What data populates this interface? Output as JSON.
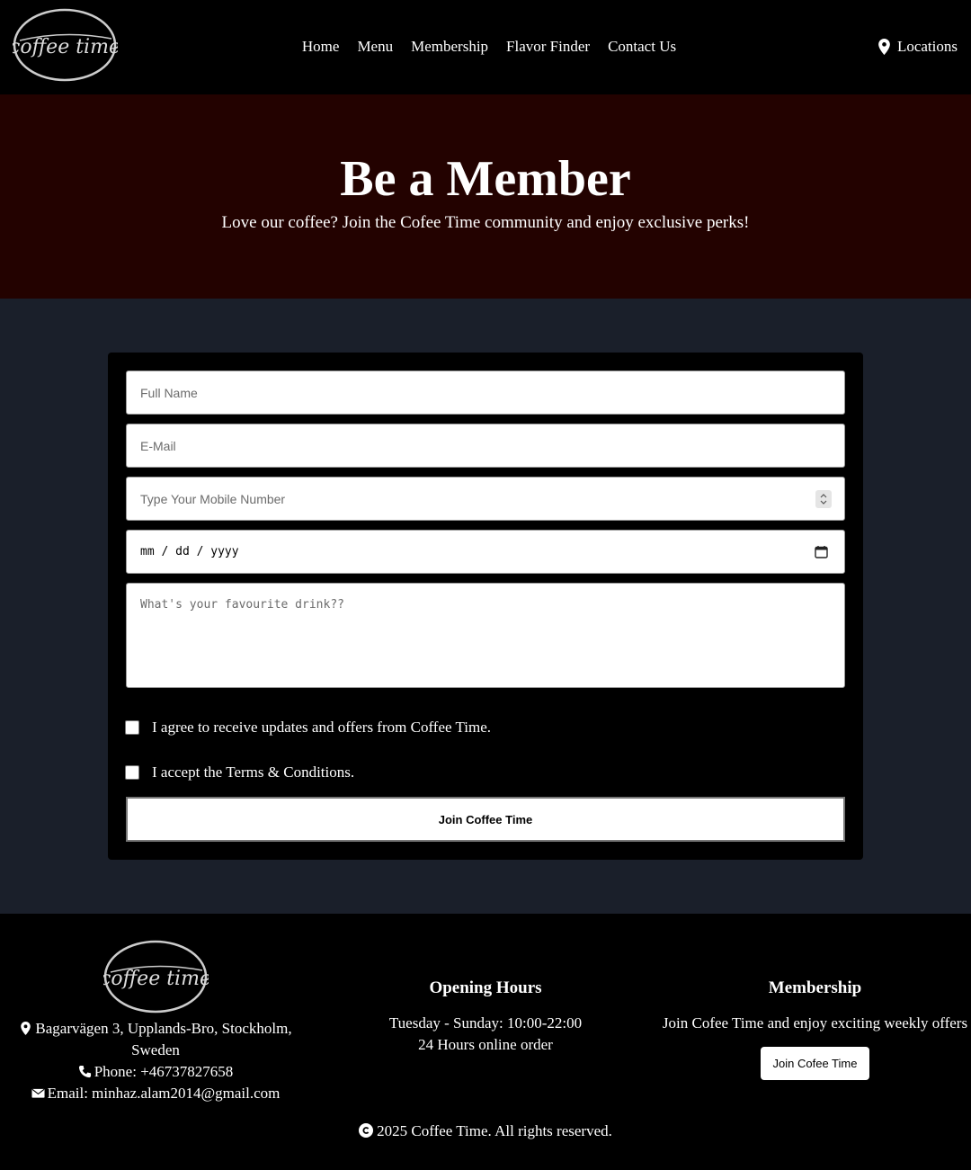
{
  "brand": {
    "logo_text": "coffee time"
  },
  "nav": {
    "items": [
      {
        "label": "Home"
      },
      {
        "label": "Menu"
      },
      {
        "label": "Membership"
      },
      {
        "label": "Flavor Finder"
      },
      {
        "label": "Contact Us"
      }
    ],
    "locations_label": "Locations",
    "locations_icon": "map-pin-icon"
  },
  "hero": {
    "title": "Be a Member",
    "subtitle": "Love our coffee? Join the Cofee Time community and enjoy exclusive perks!",
    "background": "#230200"
  },
  "form": {
    "full_name_placeholder": "Full Name",
    "email_placeholder": "E-Mail",
    "mobile_placeholder": "Type Your Mobile Number",
    "date_value": "mm / dd / yyyy",
    "drink_placeholder": "What's your favourite drink??",
    "agree_updates_label": "I agree to receive updates and offers from Coffee Time.",
    "accept_terms_label": "I accept the Terms & Conditions.",
    "submit_label": "Join Coffee Time"
  },
  "footer": {
    "address": "Bagarvägen 3, Upplands-Bro, Stockholm, Sweden",
    "phone": "Phone: +46737827658",
    "email": "Email: minhaz.alam2014@gmail.com",
    "hours_title": "Opening Hours",
    "hours_line1": "Tuesday - Sunday: 10:00-22:00",
    "hours_line2": "24 Hours online order",
    "membership_title": "Membership",
    "membership_text": "Join Cofee Time and enjoy exciting weekly offers",
    "membership_button": "Join Cofee Time",
    "copyright": "2025 Coffee Time. All rights reserved."
  },
  "colors": {
    "header_bg": "#000000",
    "main_bg": "#1a1f2a",
    "card_bg": "#000000"
  }
}
